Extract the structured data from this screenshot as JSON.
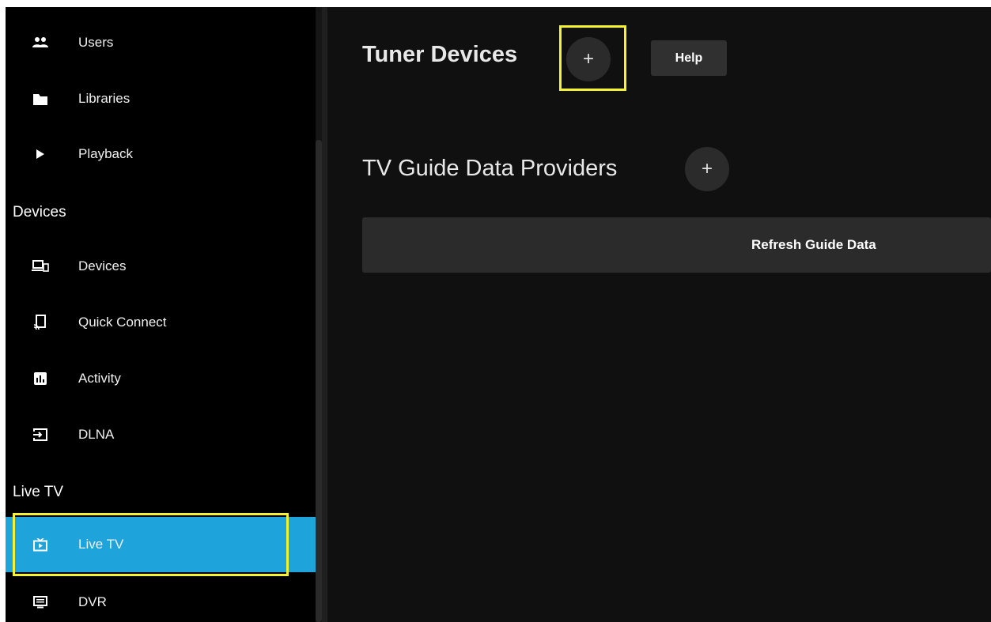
{
  "sidebar": {
    "items_top": [
      {
        "label": "Users",
        "icon": "users-icon"
      },
      {
        "label": "Libraries",
        "icon": "folder-icon"
      },
      {
        "label": "Playback",
        "icon": "play-icon"
      }
    ],
    "sections": [
      {
        "header": "Devices",
        "items": [
          {
            "label": "Devices",
            "icon": "devices-icon"
          },
          {
            "label": "Quick Connect",
            "icon": "cast-icon"
          },
          {
            "label": "Activity",
            "icon": "activity-icon"
          },
          {
            "label": "DLNA",
            "icon": "input-icon"
          }
        ]
      },
      {
        "header": "Live TV",
        "items": [
          {
            "label": "Live TV",
            "icon": "live-tv-icon",
            "active": true
          },
          {
            "label": "DVR",
            "icon": "dvr-icon"
          }
        ]
      }
    ]
  },
  "main": {
    "tuner_devices_title": "Tuner Devices",
    "add_symbol": "+",
    "help_label": "Help",
    "guide_providers_title": "TV Guide Data Providers",
    "refresh_label": "Refresh Guide Data"
  },
  "colors": {
    "accent": "#1ea3db",
    "highlight": "#f5f232",
    "background": "#101010",
    "sidebar_background": "#000000"
  }
}
